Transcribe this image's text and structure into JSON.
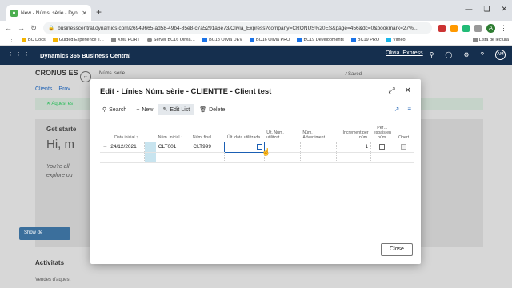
{
  "browser": {
    "tab_title": "New - Núms. sèrie - Dynamics 3…",
    "tab_favicon": "bc-icon",
    "new_tab": "+",
    "url": "businesscentral.dynamics.com/26949665-ad58-49b4-85e8-c7a5291a6e73/Olivia_Express?company=CRONUS%20ES&page=456&dc=0&bookmark=27%…",
    "avatar_letter": "A",
    "bookmarks": [
      {
        "label": "BC Docs",
        "color": "#f4b400"
      },
      {
        "label": "Guided Experience li…",
        "color": "#f4b400"
      },
      {
        "label": "XML PORT",
        "color": "#888888"
      },
      {
        "label": "Server BC16 Olivia…",
        "color": "#888888"
      },
      {
        "label": "BC18 Olivia DEV",
        "color": "#1a73e8"
      },
      {
        "label": "BC16 Olivia PRO",
        "color": "#1a73e8"
      },
      {
        "label": "BC19 Developments",
        "color": "#1a73e8"
      },
      {
        "label": "BC19 PRO",
        "color": "#1a73e8"
      },
      {
        "label": "Vimeo",
        "color": "#1ab7ea"
      }
    ],
    "reading_list": "Lista de lectura"
  },
  "app": {
    "title": "Dynamics 365 Business Central",
    "company": "Olivia_Express"
  },
  "background": {
    "cronus": "CRONUS ES",
    "breadcrumb": "Núms. sèrie",
    "saved": "✓Saved",
    "nav_clients": "Clients",
    "nav_prov": "Prov",
    "banner": "✕ Aquest es",
    "get_started": "Get starte",
    "hi": "Hi, m",
    "text_line1": "You're all",
    "text_line2": "explore ou",
    "show_button": "Show de",
    "activitats": "Activitats",
    "vendes": "Vendes d'aquest"
  },
  "modal": {
    "title": "Edit - Línies Núm. sèrie - CLIENTTE - Client test",
    "toolbar": {
      "search": "Search",
      "new": "New",
      "edit_list": "Edit List",
      "delete": "Delete"
    },
    "columns": [
      "Data inicial ↑",
      "Núm. inicial ↑",
      "Núm. final",
      "Últ. data utilitzada",
      "Últ. Núm. utilitzat",
      "Núm. Advertiment",
      "Increment per núm.",
      "Per… espais en núm.",
      "Obert"
    ],
    "row": {
      "start_date": "24/12/2021",
      "start_no": "CLT001",
      "end_no": "CLT999",
      "last_date_used": "",
      "last_no_used": "",
      "warning_no": "",
      "increment": "1"
    },
    "close_label": "Close"
  },
  "colors": {
    "bc_header": "#152f4e",
    "accent": "#1a5fb4",
    "row_highlight": "#c8e4ef"
  }
}
